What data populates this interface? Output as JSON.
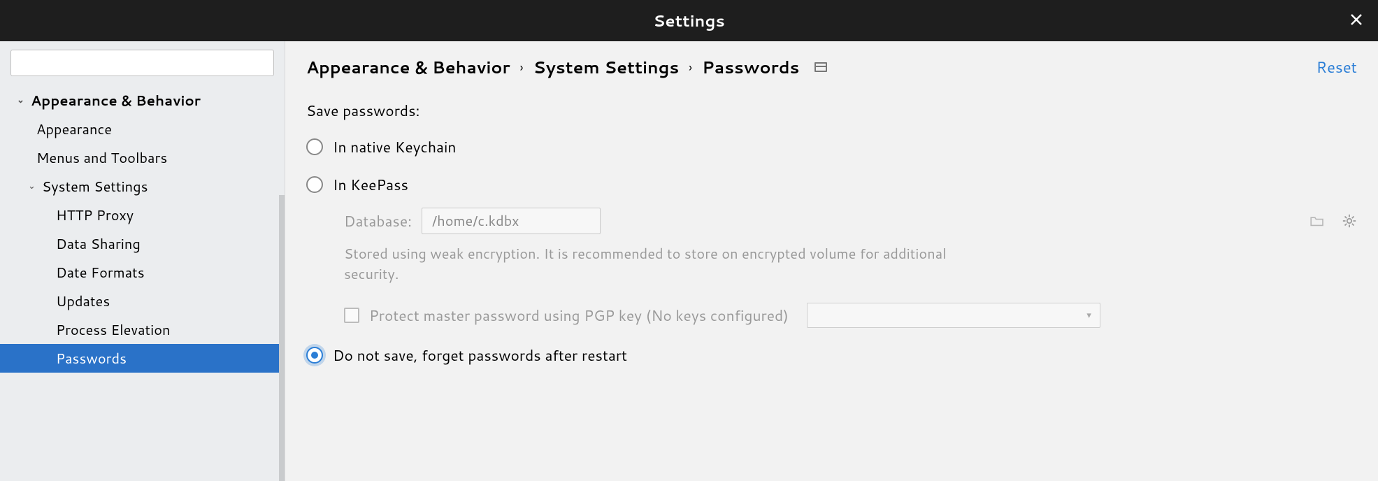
{
  "window": {
    "title": "Settings"
  },
  "search": {
    "value": ""
  },
  "sidebar": {
    "items": [
      {
        "label": "Appearance & Behavior",
        "level": 0,
        "expandable": true
      },
      {
        "label": "Appearance",
        "level": 1
      },
      {
        "label": "Menus and Toolbars",
        "level": 1
      },
      {
        "label": "System Settings",
        "level": 1,
        "expandable": true
      },
      {
        "label": "HTTP Proxy",
        "level": 2
      },
      {
        "label": "Data Sharing",
        "level": 2
      },
      {
        "label": "Date Formats",
        "level": 2
      },
      {
        "label": "Updates",
        "level": 2
      },
      {
        "label": "Process Elevation",
        "level": 2
      },
      {
        "label": "Passwords",
        "level": 2,
        "selected": true
      }
    ]
  },
  "breadcrumb": {
    "parts": [
      "Appearance & Behavior",
      "System Settings",
      "Passwords"
    ],
    "reset": "Reset"
  },
  "page": {
    "section_label": "Save passwords:",
    "option_native": "In native Keychain",
    "option_keepass": "In KeePass",
    "option_dontsave": "Do not save, forget passwords after restart",
    "selected": "dontsave",
    "database": {
      "label": "Database:",
      "value": "/home/c.kdbx",
      "hint": "Stored using weak encryption. It is recommended to store on encrypted volume for additional security."
    },
    "pgp": {
      "label": "Protect master password using PGP key (No keys configured)"
    }
  }
}
